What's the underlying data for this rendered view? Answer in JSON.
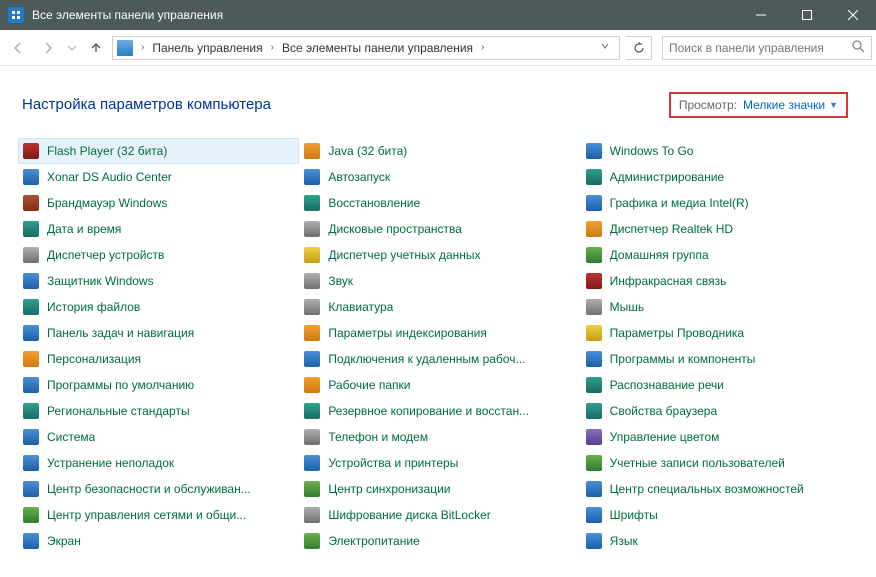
{
  "window": {
    "title": "Все элементы панели управления"
  },
  "breadcrumb": {
    "root": "Панель управления",
    "current": "Все элементы панели управления"
  },
  "search": {
    "placeholder": "Поиск в панели управления"
  },
  "header": {
    "title": "Настройка параметров компьютера",
    "view_label": "Просмотр:",
    "view_value": "Мелкие значки"
  },
  "items": [
    {
      "label": "Flash Player (32 бита)",
      "icon": "i-red",
      "selected": true
    },
    {
      "label": "Xonar DS Audio Center",
      "icon": "i-blue"
    },
    {
      "label": "Брандмауэр Windows",
      "icon": "i-brick"
    },
    {
      "label": "Дата и время",
      "icon": "i-teal"
    },
    {
      "label": "Диспетчер устройств",
      "icon": "i-gray"
    },
    {
      "label": "Защитник Windows",
      "icon": "i-blue"
    },
    {
      "label": "История файлов",
      "icon": "i-teal"
    },
    {
      "label": "Панель задач и навигация",
      "icon": "i-blue"
    },
    {
      "label": "Персонализация",
      "icon": "i-orange"
    },
    {
      "label": "Программы по умолчанию",
      "icon": "i-blue"
    },
    {
      "label": "Региональные стандарты",
      "icon": "i-teal"
    },
    {
      "label": "Система",
      "icon": "i-blue"
    },
    {
      "label": "Устранение неполадок",
      "icon": "i-blue"
    },
    {
      "label": "Центр безопасности и обслуживан...",
      "icon": "i-blue"
    },
    {
      "label": "Центр управления сетями и общи...",
      "icon": "i-green"
    },
    {
      "label": "Java (32 бита)",
      "icon": "i-orange"
    },
    {
      "label": "Автозапуск",
      "icon": "i-blue"
    },
    {
      "label": "Восстановление",
      "icon": "i-teal"
    },
    {
      "label": "Дисковые пространства",
      "icon": "i-gray"
    },
    {
      "label": "Диспетчер учетных данных",
      "icon": "i-yellow"
    },
    {
      "label": "Звук",
      "icon": "i-gray"
    },
    {
      "label": "Клавиатура",
      "icon": "i-gray"
    },
    {
      "label": "Параметры индексирования",
      "icon": "i-orange"
    },
    {
      "label": "Подключения к удаленным рабоч...",
      "icon": "i-blue"
    },
    {
      "label": "Рабочие папки",
      "icon": "i-orange"
    },
    {
      "label": "Резервное копирование и восстан...",
      "icon": "i-teal"
    },
    {
      "label": "Телефон и модем",
      "icon": "i-gray"
    },
    {
      "label": "Устройства и принтеры",
      "icon": "i-blue"
    },
    {
      "label": "Центр синхронизации",
      "icon": "i-green"
    },
    {
      "label": "Шифрование диска BitLocker",
      "icon": "i-gray"
    },
    {
      "label": "Windows To Go",
      "icon": "i-blue"
    },
    {
      "label": "Администрирование",
      "icon": "i-teal"
    },
    {
      "label": "Графика и медиа Intel(R)",
      "icon": "i-blue"
    },
    {
      "label": "Диспетчер Realtek HD",
      "icon": "i-orange"
    },
    {
      "label": "Домашняя группа",
      "icon": "i-green"
    },
    {
      "label": "Инфракрасная связь",
      "icon": "i-red"
    },
    {
      "label": "Мышь",
      "icon": "i-gray"
    },
    {
      "label": "Параметры Проводника",
      "icon": "i-yellow"
    },
    {
      "label": "Программы и компоненты",
      "icon": "i-blue"
    },
    {
      "label": "Распознавание речи",
      "icon": "i-teal"
    },
    {
      "label": "Свойства браузера",
      "icon": "i-teal"
    },
    {
      "label": "Управление цветом",
      "icon": "i-purple"
    },
    {
      "label": "Учетные записи пользователей",
      "icon": "i-green"
    },
    {
      "label": "Центр специальных возможностей",
      "icon": "i-blue"
    },
    {
      "label": "Шрифты",
      "icon": "i-blue"
    },
    {
      "label": "Экран",
      "icon": "i-blue"
    },
    {
      "label": "Электропитание",
      "icon": "i-green"
    },
    {
      "label": "Язык",
      "icon": "i-blue"
    }
  ]
}
